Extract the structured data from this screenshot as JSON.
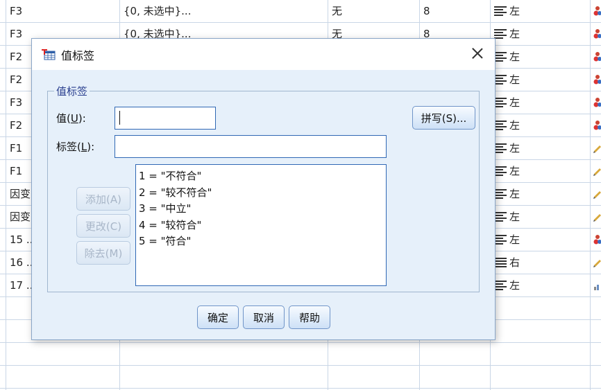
{
  "spreadsheet": {
    "rows": [
      {
        "name": "F3",
        "values": "{0, 未选中}...",
        "missing": "无",
        "columns": "8",
        "align": "左"
      },
      {
        "name": "F3",
        "values": "{0, 未选中}...",
        "missing": "无",
        "columns": "8",
        "align": "左"
      },
      {
        "name": "F2",
        "values": "",
        "missing": "",
        "columns": "",
        "align": "左"
      },
      {
        "name": "F2",
        "values": "",
        "missing": "",
        "columns": "",
        "align": "左"
      },
      {
        "name": "F3",
        "values": "",
        "missing": "",
        "columns": "",
        "align": "左"
      },
      {
        "name": "F2",
        "values": "",
        "missing": "",
        "columns": "",
        "align": "左"
      },
      {
        "name": "F1",
        "values": "",
        "missing": "",
        "columns": "",
        "align": "左"
      },
      {
        "name": "F1",
        "values": "",
        "missing": "",
        "columns": "",
        "align": "左"
      },
      {
        "name": "因变",
        "values": "",
        "missing": "",
        "columns": "",
        "align": "左"
      },
      {
        "name": "因变",
        "values": "",
        "missing": "",
        "columns": "",
        "align": "左"
      },
      {
        "name": "15 ...",
        "values": "",
        "missing": "",
        "columns": "",
        "align": "左"
      },
      {
        "name": "16 ...",
        "values": "",
        "missing": "",
        "columns": "",
        "align": "右"
      },
      {
        "name": "17 ...",
        "values": "",
        "missing": "",
        "columns": "",
        "align": "左"
      },
      {
        "name": "",
        "values": "",
        "missing": "",
        "columns": "",
        "align": ""
      },
      {
        "name": "",
        "values": "",
        "missing": "",
        "columns": "",
        "align": ""
      },
      {
        "name": "",
        "values": "",
        "missing": "",
        "columns": "",
        "align": ""
      },
      {
        "name": "",
        "values": "",
        "missing": "",
        "columns": "",
        "align": ""
      }
    ],
    "measure_icons": [
      "nominal-icon",
      "nominal-icon",
      "nominal-icon",
      "nominal-icon",
      "nominal-icon",
      "nominal-icon",
      "scale-icon",
      "scale-icon",
      "scale-icon",
      "scale-icon",
      "nominal-icon",
      "scale-icon",
      "ordinal-icon"
    ]
  },
  "dialog": {
    "title": "值标签",
    "group_title": "值标签",
    "value_label": "值(",
    "value_hotkey": "U",
    "value_label_end": "):",
    "label_label": "标签(",
    "label_hotkey": "L",
    "label_label_end": "):",
    "value_input": "",
    "label_input": "",
    "spelling_button": "拼写(S)...",
    "add_button": "添加(A)",
    "change_button": "更改(C)",
    "remove_button": "除去(M)",
    "value_labels": [
      "1 = \"不符合\"",
      "2 = \"较不符合\"",
      "3 = \"中立\"",
      "4 = \"较符合\"",
      "5 = \"符合\""
    ],
    "ok_button": "确定",
    "cancel_button": "取消",
    "help_button": "帮助"
  }
}
